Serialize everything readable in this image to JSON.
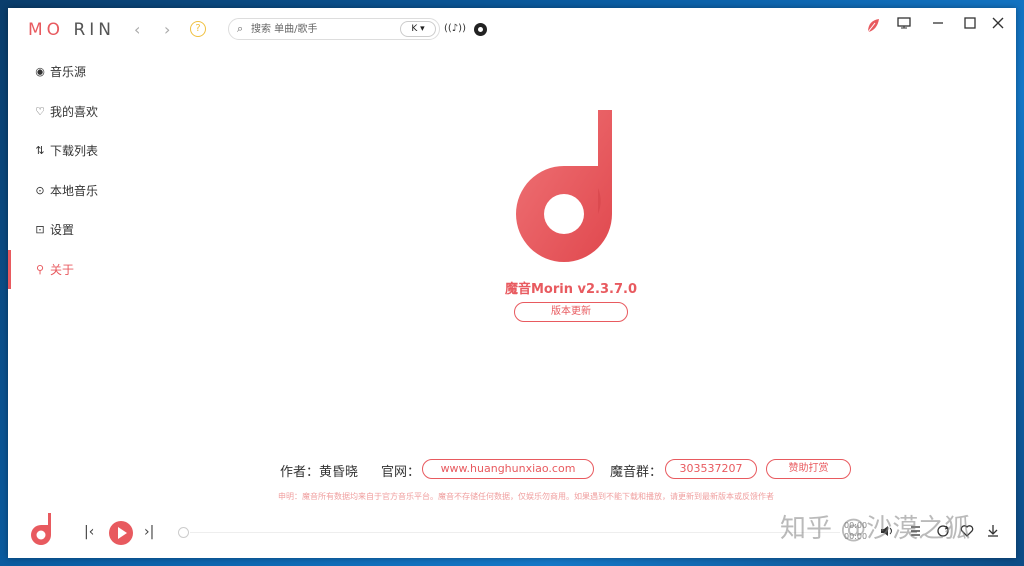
{
  "app": {
    "logo_part1": "MO",
    "logo_part2": " RIN",
    "accent_color": "#e85a5f"
  },
  "titlebar": {
    "back_icon": "chevron-left-icon",
    "forward_icon": "chevron-right-icon",
    "help_glyph": "?",
    "search_placeholder": "搜索 单曲/歌手",
    "source_value": "K ▾",
    "radio_glyph": "((♪))"
  },
  "sidebar": {
    "items": [
      {
        "icon": "◉",
        "label": "音乐源"
      },
      {
        "icon": "♡",
        "label": "我的喜欢"
      },
      {
        "icon": "⇅",
        "label": "下载列表"
      },
      {
        "icon": "⊙",
        "label": "本地音乐"
      },
      {
        "icon": "⊡",
        "label": "设置"
      },
      {
        "icon": "⚲",
        "label": "关于"
      }
    ]
  },
  "about": {
    "version": "魔音Morin v2.3.7.0",
    "update_label": "版本更新",
    "author_label": "作者：黄昏晓",
    "site_label": "官网：",
    "site_url": "www.huanghunxiao.com",
    "group_label": "魔音群：",
    "group_number": "303537207",
    "donate_label": "赞助打赏",
    "disclaimer": "申明：魔音所有数据均来自于官方音乐平台。魔音不存储任何数据，仅娱乐勿商用。如果遇到不能下载和播放，请更新到最新版本或反馈作者"
  },
  "player": {
    "prev_glyph": "|‹",
    "next_glyph": "›|",
    "time_current": "00:00",
    "time_total": "00:00",
    "progress": 0
  },
  "watermark": "知乎 @沙漠之狐"
}
